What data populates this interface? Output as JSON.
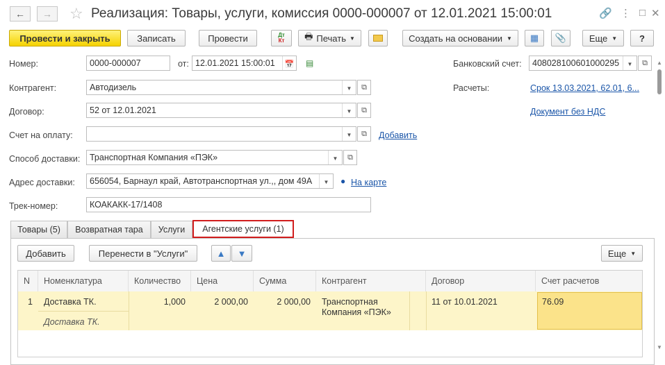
{
  "window": {
    "title": "Реализация: Товары, услуги, комиссия 0000-000007 от 12.01.2021 15:00:01",
    "back_icon": "arrow-left-icon",
    "forward_icon": "arrow-right-icon",
    "favorite_icon": "star-icon"
  },
  "toolbar": {
    "post_close": "Провести и закрыть",
    "save": "Записать",
    "post": "Провести",
    "dt_kt_top": "Дт",
    "dt_kt_bottom": "Кт",
    "print": "Печать",
    "create_based": "Создать на основании",
    "more": "Еще",
    "help": "?"
  },
  "form": {
    "number_label": "Номер:",
    "number_value": "0000-000007",
    "date_label": "от:",
    "date_value": "12.01.2021 15:00:01",
    "bank_label": "Банковский счет:",
    "bank_value": "40802810060100029​5",
    "contractor_label": "Контрагент:",
    "contractor_value": "Автодизель",
    "settlements_label": "Расчеты:",
    "settlements_link": "Срок 13.03.2021, 62.01, 6...",
    "contract_label": "Договор:",
    "contract_value": "52 от 12.01.2021",
    "vat_link": "Документ без НДС",
    "invoice_label": "Счет на оплату:",
    "invoice_value": "",
    "invoice_add": "Добавить",
    "delivery_label": "Способ доставки:",
    "delivery_value": "Транспортная Компания «ПЭК»",
    "address_label": "Адрес доставки:",
    "address_value": "656054, Барнаул край, Автотранспортная ул.,, дом 49А",
    "map_link": "На карте",
    "track_label": "Трек-номер:",
    "track_value": "КОАКАКК-17/1408"
  },
  "tabs": [
    {
      "label": "Товары (5)"
    },
    {
      "label": "Возвратная тара"
    },
    {
      "label": "Услуги"
    },
    {
      "label": "Агентские услуги (1)"
    }
  ],
  "table_toolbar": {
    "add": "Добавить",
    "move": "Перенести в \"Услуги\"",
    "more": "Еще"
  },
  "table": {
    "columns": [
      "N",
      "Номенклатура",
      "Количество",
      "Цена",
      "Сумма",
      "Контрагент",
      "Договор",
      "Счет расчетов"
    ],
    "rows": [
      {
        "n": "1",
        "item": "Доставка ТК.",
        "item_desc": "Доставка ТК.",
        "qty": "1,000",
        "price": "2 000,00",
        "sum": "2 000,00",
        "contractor_line1": "Транспортная",
        "contractor_line2": "Компания «ПЭК»",
        "contract": "11 от 10.01.2021",
        "account": "76.09"
      }
    ]
  },
  "colors": {
    "primary_button": "#f5d200",
    "link": "#1a55a8",
    "active_tab_border": "#d11d1d",
    "row_highlight": "#fdf5c9",
    "selected_cell": "#fbe38a"
  }
}
